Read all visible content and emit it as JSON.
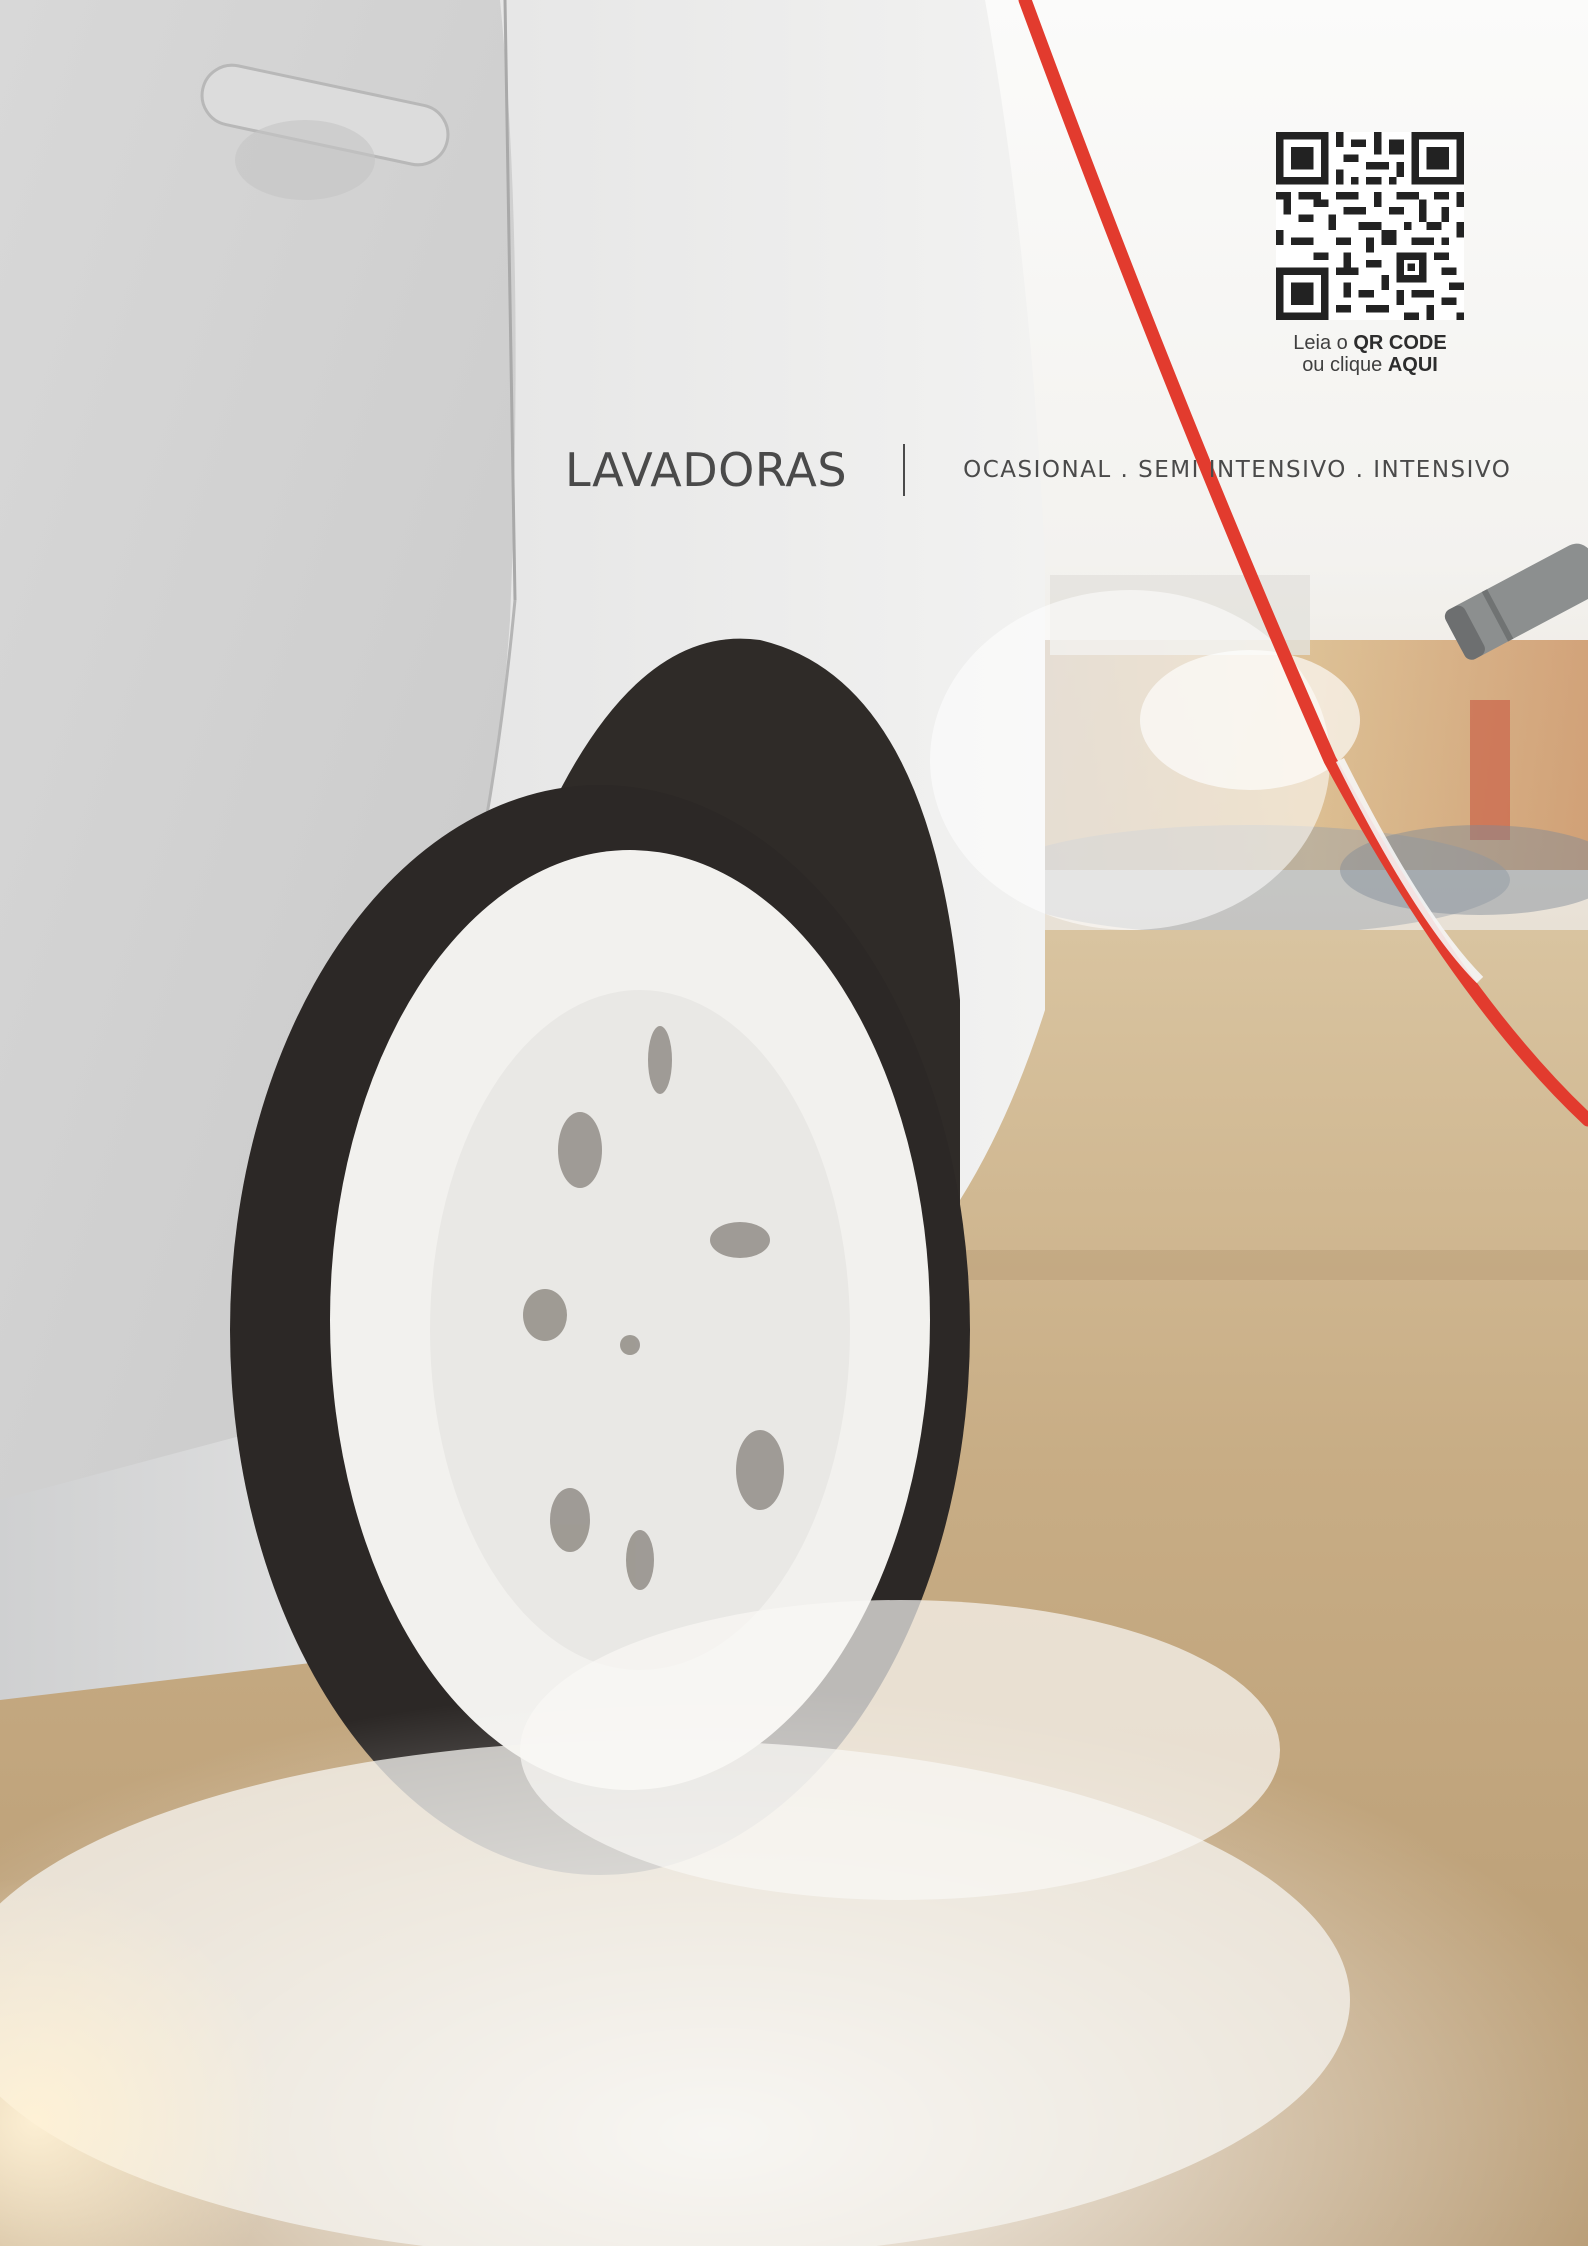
{
  "header": {
    "title": "LAVADORAS",
    "subtitle": "OCASIONAL . SEMI INTENSIVO . INTENSIVO"
  },
  "qr": {
    "line1_prefix": "Leia o ",
    "line1_strong": "QR CODE",
    "line2_prefix": "ou clique ",
    "line2_strong": "AQUI"
  },
  "colors": {
    "text": "#4a4a4a",
    "hose": "#e23b2e",
    "foam": "#f7f6f3"
  },
  "icons": {
    "qr": "qr-code-icon"
  }
}
